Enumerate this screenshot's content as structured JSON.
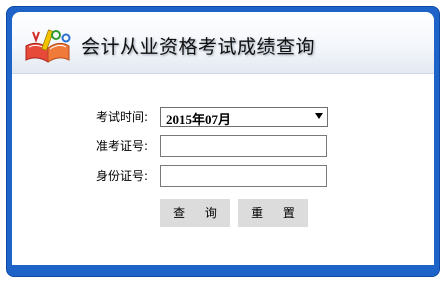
{
  "header": {
    "title": "会计从业资格考试成绩查询",
    "logo_icon": "book-pencil-logo-icon"
  },
  "form": {
    "exam_time_label": "考试时间:",
    "exam_time_value": "2015年07月",
    "admission_label": "准考证号:",
    "admission_value": "",
    "id_label": "身份证号:",
    "id_value": ""
  },
  "buttons": {
    "query_label": "查 询",
    "reset_label": "重 置"
  },
  "colors": {
    "frame_blue": "#1e64c8",
    "button_gray": "#dcdcdc"
  }
}
